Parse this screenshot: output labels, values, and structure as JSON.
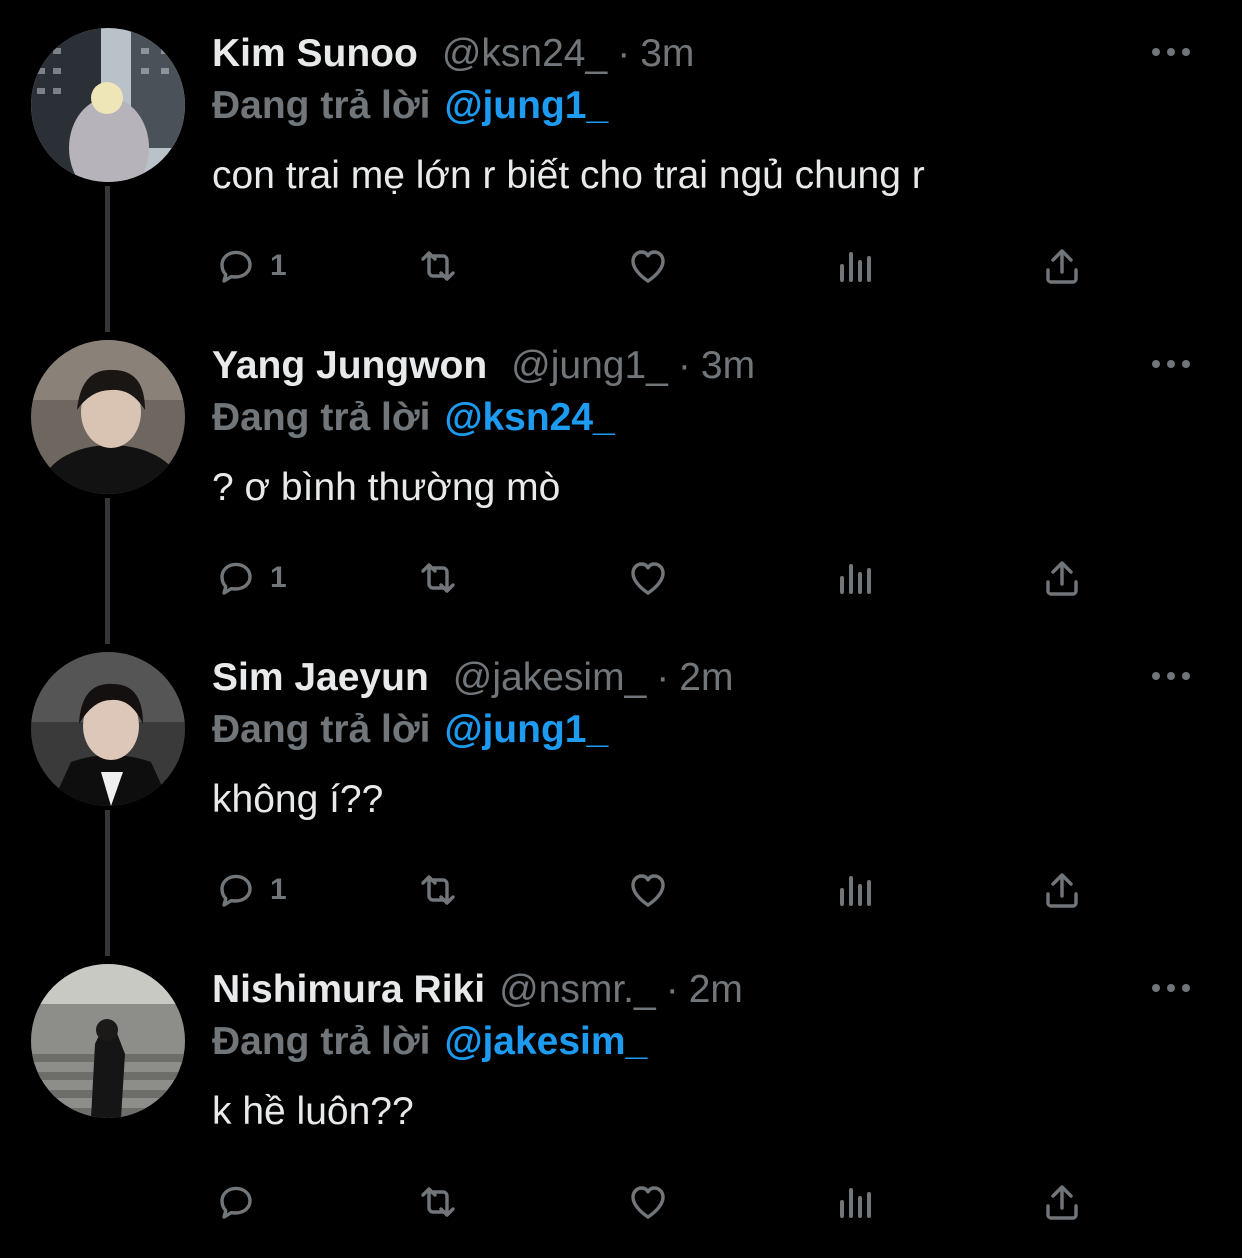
{
  "colors": {
    "background": "#000000",
    "text": "#e7e9ea",
    "muted": "#71767b",
    "accent": "#1d9bf0",
    "thread_line": "#333639"
  },
  "icons": {
    "reply": "reply-icon",
    "retweet": "retweet-icon",
    "like": "heart-icon",
    "views": "analytics-icon",
    "share": "share-icon",
    "more": "more-icon"
  },
  "tweets": [
    {
      "name": "Kim Sunoo",
      "handle": "@ksn24_",
      "separator": "·",
      "time": "3m",
      "replying_label": "Đang trả lời",
      "replying_to": "@jung1_",
      "text": "con trai mẹ lớn r biết cho trai ngủ chung r",
      "reply_count": "1"
    },
    {
      "name": "Yang Jungwon",
      "handle": "@jung1_",
      "separator": "·",
      "time": "3m",
      "replying_label": "Đang trả lời",
      "replying_to": "@ksn24_",
      "text": "? ơ bình thường mò",
      "reply_count": "1"
    },
    {
      "name": "Sim Jaeyun",
      "handle": "@jakesim_",
      "separator": "·",
      "time": "2m",
      "replying_label": "Đang trả lời",
      "replying_to": "@jung1_",
      "text": "không í??",
      "reply_count": "1"
    },
    {
      "name": "Nishimura Riki",
      "handle": "@nsmr._",
      "separator": "·",
      "time": "2m",
      "replying_label": "Đang trả lời",
      "replying_to": "@jakesim_",
      "text": "k hề luôn??",
      "reply_count": ""
    }
  ]
}
